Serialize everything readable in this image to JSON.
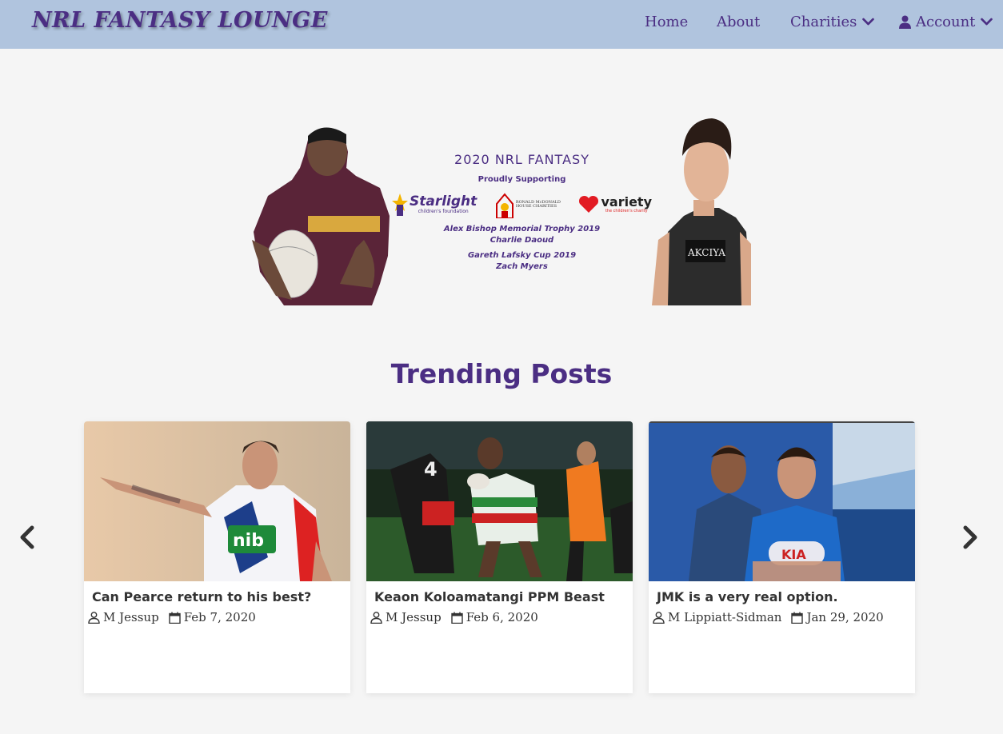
{
  "navbar": {
    "brand": "NRL FANTASY LOUNGE",
    "home": "Home",
    "about": "About",
    "charities": "Charities",
    "account": "Account"
  },
  "hero": {
    "title": "2020 NRL FANTASY",
    "subtitle": "Proudly Supporting",
    "charities": {
      "starlight": "Starlight",
      "starlight_tag": "children's foundation",
      "rmhc_line1": "RONALD McDONALD",
      "rmhc_line2": "HOUSE CHARITIES",
      "variety": "variety",
      "variety_tag": "the children's charity"
    },
    "trophy1": "Alex Bishop Memorial Trophy 2019",
    "winner1": "Charlie Daoud",
    "trophy2": "Gareth Lafsky Cup 2019",
    "winner2": "Zach Myers"
  },
  "trending": {
    "title": "Trending Posts",
    "posts": [
      {
        "title": "Can Pearce return to his best?",
        "author": "M Jessup",
        "date": "Feb 7, 2020"
      },
      {
        "title": "Keaon Koloamatangi PPM Beast",
        "author": "M Jessup",
        "date": "Feb 6, 2020"
      },
      {
        "title": "JMK is a very real option.",
        "author": "M Lippiatt-Sidman",
        "date": "Jan 29, 2020"
      }
    ]
  },
  "colors": {
    "navbar": "#b0c4de",
    "brand": "#4b2e83",
    "background": "#f5f5f5"
  },
  "icons": [
    "chevron-down-icon",
    "user-icon",
    "calendar-icon",
    "chevron-left-icon",
    "chevron-right-icon"
  ]
}
